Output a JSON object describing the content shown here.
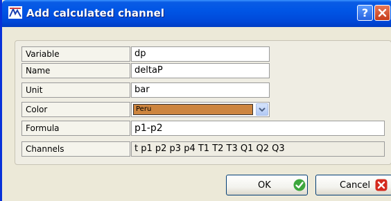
{
  "window": {
    "title": "Add calculated channel",
    "help_glyph": "?",
    "icon": "app-logo-icon"
  },
  "form": {
    "variable_label": "Variable",
    "variable_value": "dp",
    "name_label": "Name",
    "name_value": "deltaP",
    "unit_label": "Unit",
    "unit_value": "bar",
    "color_label": "Color",
    "color_value": "Peru",
    "color_hex": "#cd853f",
    "formula_label": "Formula",
    "formula_value": "p1-p2",
    "channels_label": "Channels",
    "channels_value": "t p1 p2 p3 p4 T1 T2 T3 Q1 Q2 Q3"
  },
  "buttons": {
    "ok_label": "OK",
    "cancel_label": "Cancel"
  },
  "colors": {
    "title_bar": "#0055e5",
    "ok_icon": "#3ca63c",
    "cancel_icon": "#d42a1e"
  }
}
